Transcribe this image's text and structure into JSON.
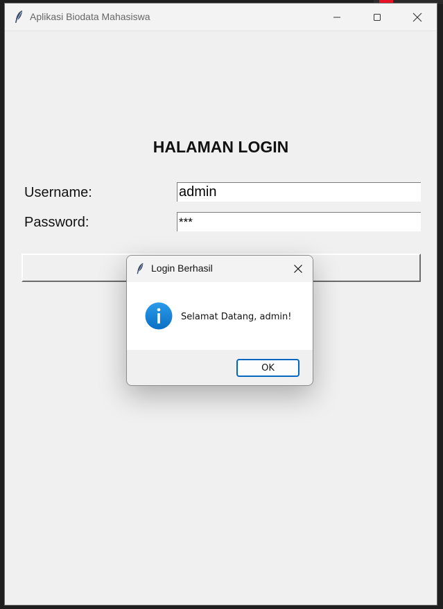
{
  "window": {
    "title": "Aplikasi Biodata Mahasiswa",
    "icons": {
      "app": "feather-icon",
      "minimize": "minimize-icon",
      "maximize": "maximize-icon",
      "close": "close-icon"
    }
  },
  "login_form": {
    "heading": "HALAMAN LOGIN",
    "username_label": "Username:",
    "username_value": "admin",
    "password_label": "Password:",
    "password_value": "***"
  },
  "dialog": {
    "title": "Login Berhasil",
    "message": "Selamat Datang, admin!",
    "ok_label": "OK",
    "icons": {
      "app": "feather-icon",
      "close": "close-icon",
      "message": "info-icon"
    },
    "accent_color": "#0067c0"
  }
}
